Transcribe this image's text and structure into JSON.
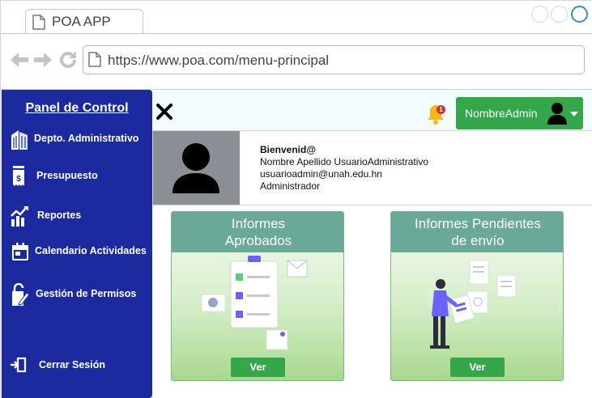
{
  "browser": {
    "tab_title": "POA APP",
    "url": "https://www.poa.com/menu-principal"
  },
  "sidebar": {
    "title": "Panel de Control",
    "items": [
      {
        "label": "Depto. Administrativo",
        "icon": "building-icon"
      },
      {
        "label": "Presupuesto",
        "icon": "receipt-icon"
      },
      {
        "label": "Reportes",
        "icon": "chart-icon"
      },
      {
        "label": "Calendario Actividades",
        "icon": "calendar-icon"
      },
      {
        "label": "Gestión de Permisos",
        "icon": "permissions-icon"
      }
    ],
    "logout": {
      "label": "Cerrar Sesión",
      "icon": "logout-icon"
    }
  },
  "header": {
    "notification_count": "1",
    "user_name": "NombreAdmin"
  },
  "welcome": {
    "greeting": "Bienvenid@",
    "full_name": "Nombre Apellido UsuarioAdministrativo",
    "email": "usuarioadmin@unah.edu.hn",
    "role": "Administrador"
  },
  "cards": [
    {
      "title_line1": "Informes",
      "title_line2": "Aprobados",
      "button": "Ver"
    },
    {
      "title_line1": "Informes Pendientes",
      "title_line2": "de envío",
      "button": "Ver"
    }
  ],
  "colors": {
    "sidebar": "#1b2a9e",
    "accent_green": "#34a74a",
    "card_header": "#6aa89a"
  }
}
